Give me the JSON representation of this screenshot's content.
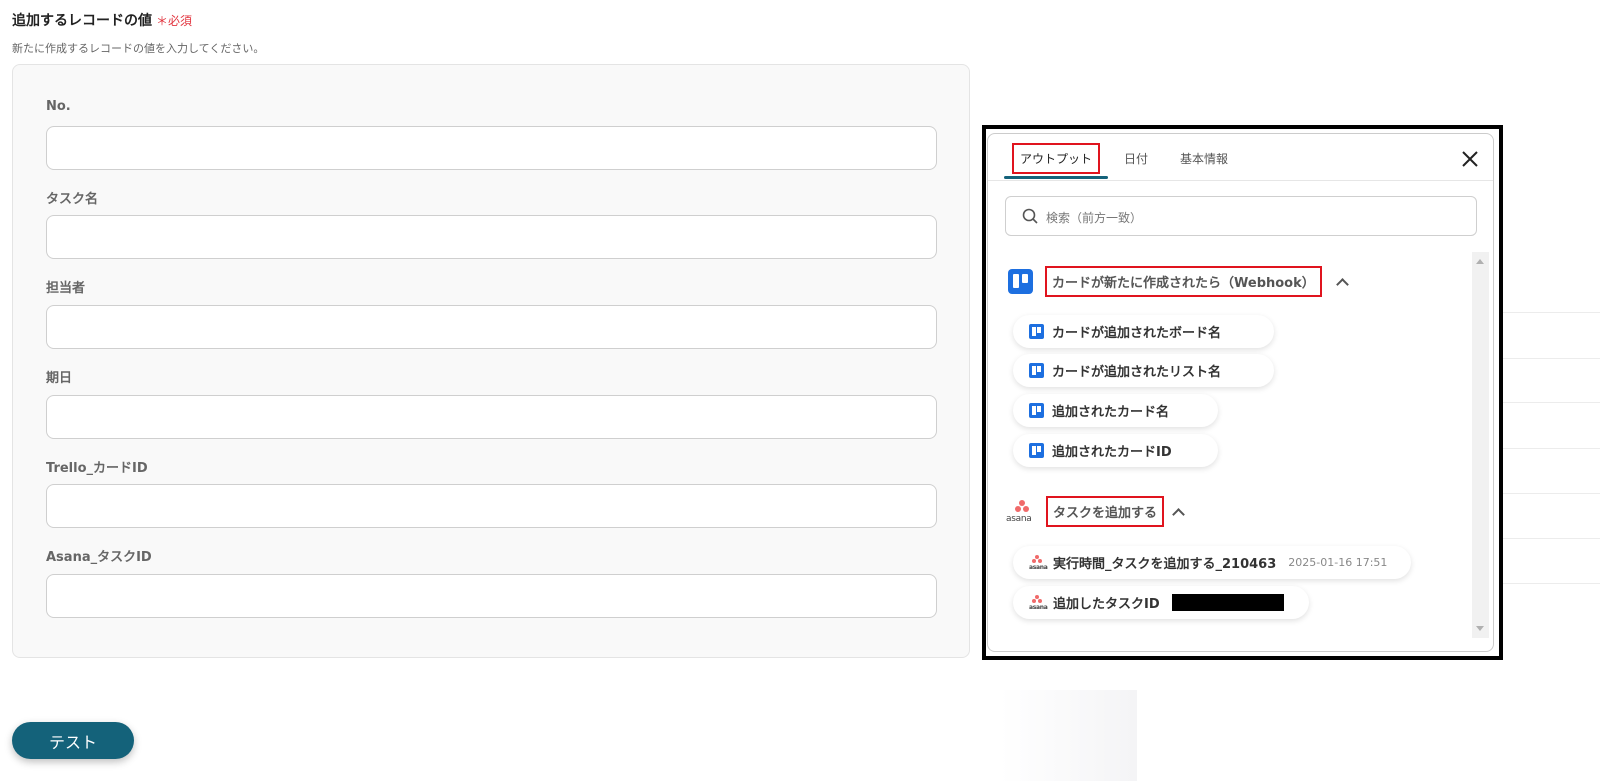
{
  "section": {
    "title": "追加するレコードの値",
    "required": "＊必須",
    "description": "新たに作成するレコードの値を入力してください。"
  },
  "fields": [
    {
      "label": "No.",
      "value": ""
    },
    {
      "label": "タスク名",
      "value": ""
    },
    {
      "label": "担当者",
      "value": ""
    },
    {
      "label": "期日",
      "value": ""
    },
    {
      "label": "Trello_カードID",
      "value": ""
    },
    {
      "label": "Asana_タスクID",
      "value": ""
    }
  ],
  "test_button": "テスト",
  "popup": {
    "tabs": [
      "アウトプット",
      "日付",
      "基本情報"
    ],
    "active_tab": "アウトプット",
    "search_placeholder": "検索（前方一致）",
    "groups": [
      {
        "title": "カードが新たに作成されたら（Webhook）",
        "icon": "trello-icon",
        "items": [
          {
            "label": "カードが追加されたボード名"
          },
          {
            "label": "カードが追加されたリスト名"
          },
          {
            "label": "追加されたカード名"
          },
          {
            "label": "追加されたカードID"
          }
        ]
      },
      {
        "title": "タスクを追加する",
        "icon": "asana-icon",
        "items": [
          {
            "label": "実行時間_タスクを追加する_210463",
            "value": "2025-01-16 17:51"
          },
          {
            "label": "追加したタスクID",
            "value": "redacted"
          }
        ]
      }
    ]
  },
  "colors": {
    "primary": "#14627a",
    "required": "#e2353f",
    "highlight_box": "#e0141e",
    "trello": "#1d6fe0",
    "asana": "#f06a6a"
  }
}
